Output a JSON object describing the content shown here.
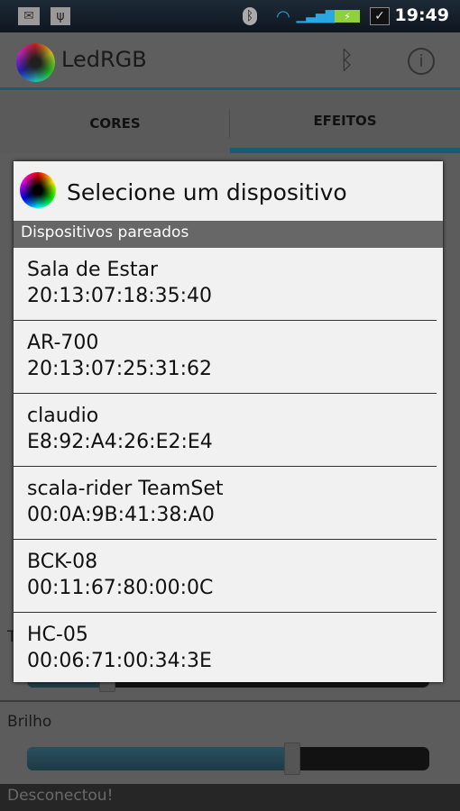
{
  "status_bar": {
    "time": "19:49",
    "icons": [
      "gmail-icon",
      "usb-icon",
      "bluetooth-icon",
      "wifi-icon",
      "signal-icon",
      "battery-charging-icon",
      "task-icon"
    ]
  },
  "action_bar": {
    "title": "LedRGB",
    "icons": [
      "color-wheel-icon",
      "bluetooth-icon",
      "info-icon"
    ]
  },
  "tabs": [
    {
      "label": "CORES",
      "selected": false
    },
    {
      "label": "EFEITOS",
      "selected": true
    }
  ],
  "background": {
    "hidden_label_initial": "T",
    "slider1_value": 0.2,
    "brightness_label": "Brilho",
    "brightness_value": 0.66
  },
  "toast": "Desconectou!",
  "dialog": {
    "title": "Selecione um dispositivo",
    "section": "Dispositivos pareados",
    "devices": [
      {
        "name": "Sala de Estar",
        "address": "20:13:07:18:35:40"
      },
      {
        "name": "AR-700",
        "address": "20:13:07:25:31:62"
      },
      {
        "name": "claudio",
        "address": "E8:92:A4:26:E2:E4"
      },
      {
        "name": "scala-rider TeamSet",
        "address": "00:0A:9B:41:38:A0"
      },
      {
        "name": "BCK-08",
        "address": "00:11:67:80:00:0C"
      },
      {
        "name": "HC-05",
        "address": "00:06:71:00:34:3E"
      }
    ]
  },
  "colors": {
    "accent": "#1a5a73",
    "dialog_bg": "#f1f1f1",
    "section_bg": "#676767"
  }
}
